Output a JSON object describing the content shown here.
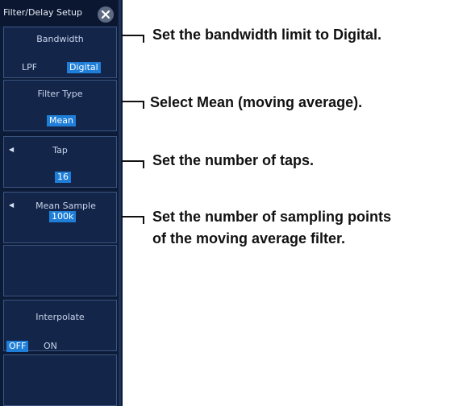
{
  "menu": {
    "title": "Filter/Delay Setup",
    "bandwidth": {
      "label": "Bandwidth",
      "options": [
        "LPF",
        "Digital"
      ]
    },
    "filter_type": {
      "label": "Filter Type",
      "value": "Mean"
    },
    "tap": {
      "label": "Tap",
      "value": "16"
    },
    "mean_sample": {
      "label": "Mean Sample",
      "value": "100k"
    },
    "interpolate": {
      "label": "Interpolate",
      "options": [
        "OFF",
        "ON"
      ]
    }
  },
  "callouts": {
    "bandwidth": "Set the bandwidth limit to Digital.",
    "filter_type": "Select Mean (moving average).",
    "tap": "Set the number of taps.",
    "mean_sample_1": "Set the number of sampling points",
    "mean_sample_2": "of the moving average filter."
  },
  "colors": {
    "panel": "#0c1b38",
    "highlight": "#1f7fd8"
  }
}
